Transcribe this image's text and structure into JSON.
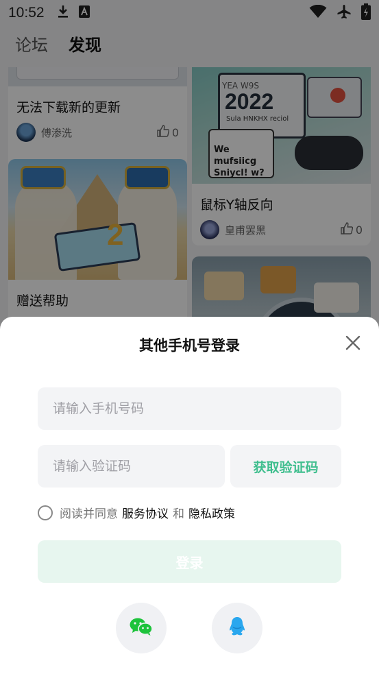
{
  "status_bar": {
    "time": "10:52",
    "icons": [
      "download-icon",
      "a-notification-icon",
      "wifi-icon",
      "airplane-icon",
      "battery-icon"
    ]
  },
  "tabs": [
    {
      "label": "论坛",
      "active": false
    },
    {
      "label": "发现",
      "active": true
    }
  ],
  "feed": {
    "cards": [
      {
        "title": "无法下载新的更新",
        "author": "傅渗洗",
        "likes": "0"
      },
      {
        "title": "鼠标Y轴反向",
        "author": "皇甫罢黑",
        "likes": "0"
      },
      {
        "title": "赠送帮助",
        "author": "",
        "likes": ""
      }
    ],
    "image_texts": {
      "card2_year": "2022",
      "card2_banner": "We mufsiicg Sniycl! w?",
      "card2_small": "Sula HNKHX reciol",
      "card1_badge": "2"
    }
  },
  "login_sheet": {
    "title": "其他手机号登录",
    "phone_placeholder": "请输入手机号码",
    "code_placeholder": "请输入验证码",
    "get_code_label": "获取验证码",
    "agree_prefix": "阅读并同意",
    "terms_label": "服务协议",
    "and_label": "和",
    "privacy_label": "隐私政策",
    "login_label": "登录",
    "social": [
      "wechat-icon",
      "qq-icon"
    ]
  },
  "colors": {
    "accent": "#3fbe8e",
    "login_disabled": "#e7f6ef",
    "field_bg": "#f3f4f6"
  }
}
